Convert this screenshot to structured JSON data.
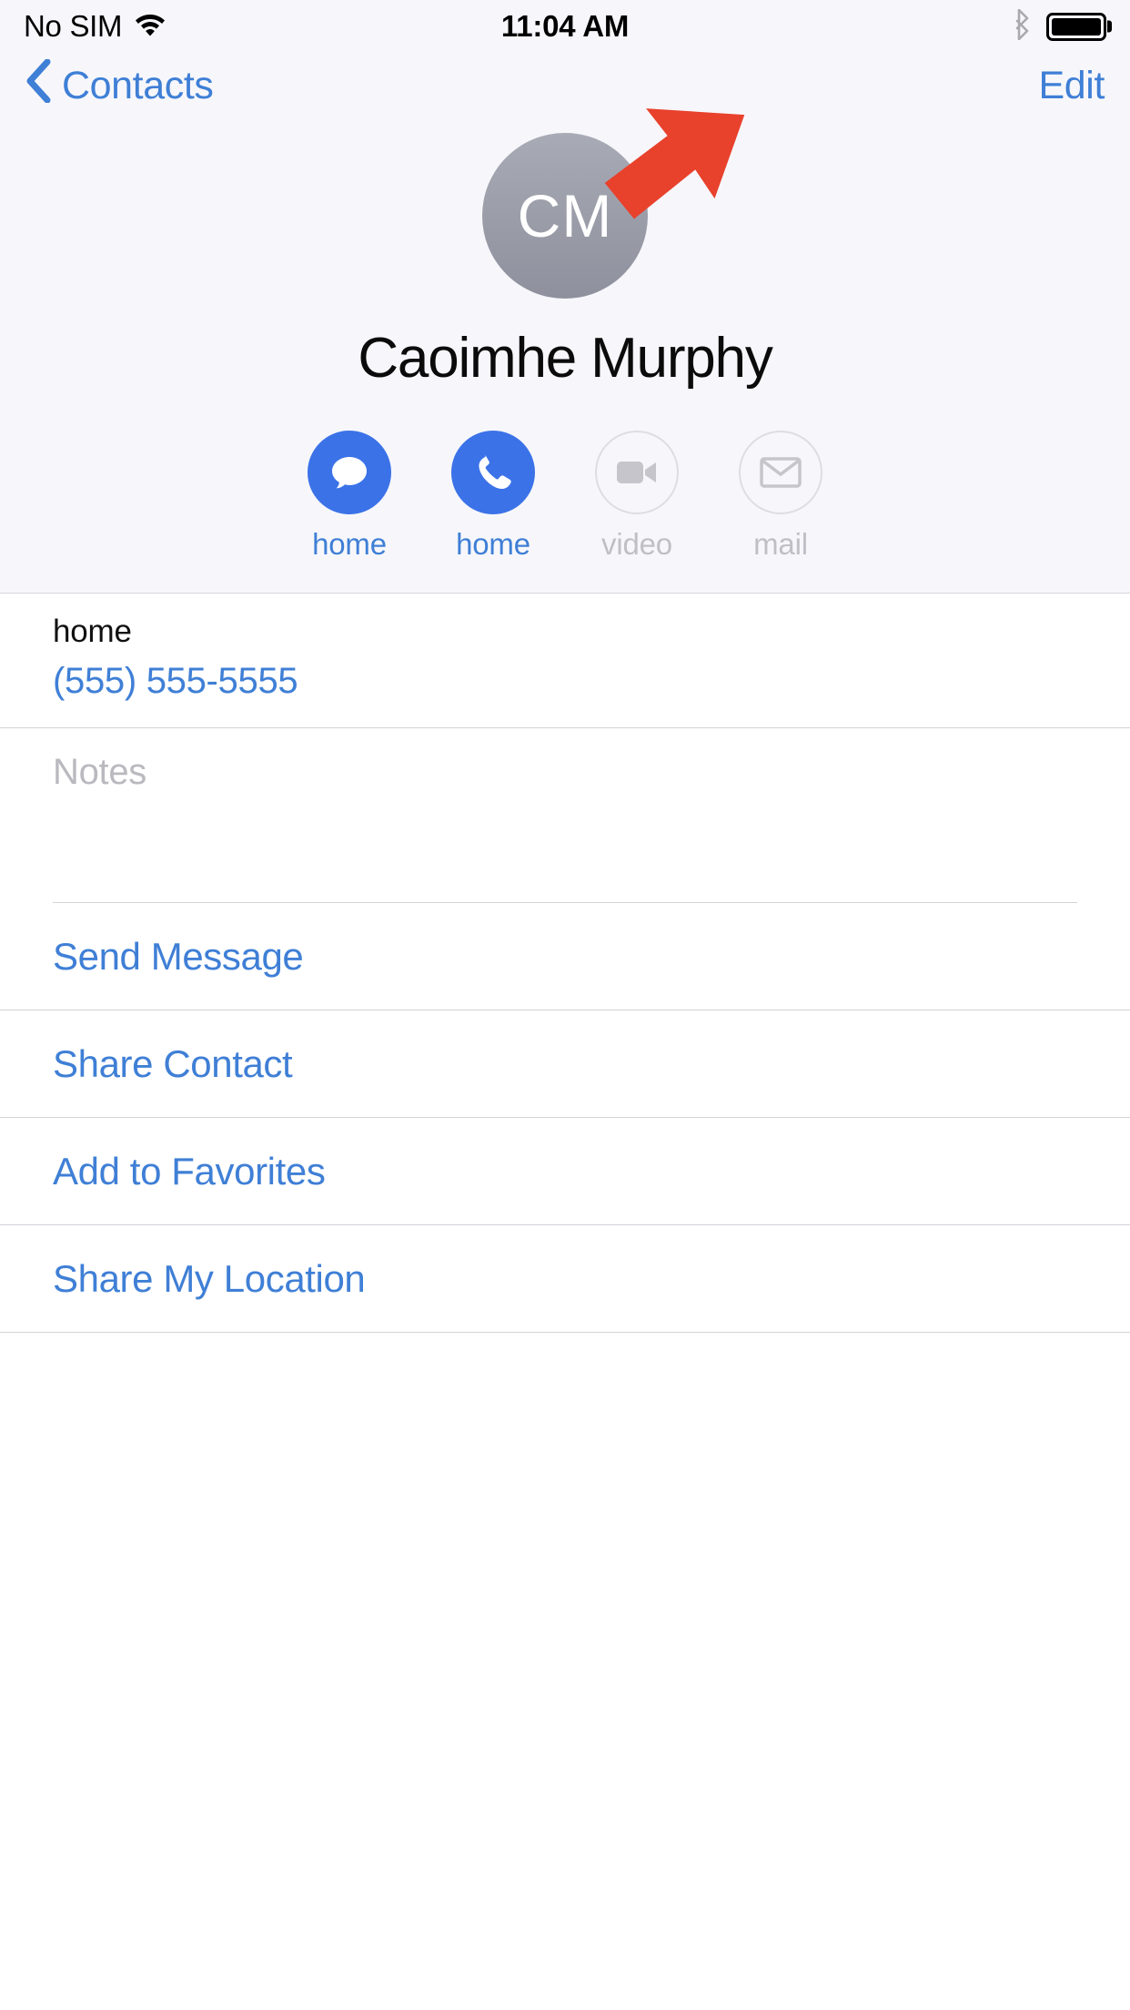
{
  "status_bar": {
    "carrier": "No SIM",
    "wifi_icon": "wifi-icon",
    "time": "11:04 AM",
    "bluetooth_icon": "bluetooth-icon",
    "battery_icon": "battery-full-icon",
    "battery_level_percent": 100
  },
  "nav_bar": {
    "back_icon": "chevron-left-icon",
    "back_label": "Contacts",
    "edit_label": "Edit"
  },
  "contact": {
    "initials": "CM",
    "name": "Caoimhe Murphy",
    "avatar_color": "#9a9da8"
  },
  "actions": [
    {
      "icon": "message-icon",
      "label": "home",
      "enabled": true
    },
    {
      "icon": "phone-icon",
      "label": "home",
      "enabled": true
    },
    {
      "icon": "video-camera-icon",
      "label": "video",
      "enabled": false
    },
    {
      "icon": "mail-icon",
      "label": "mail",
      "enabled": false
    }
  ],
  "phone_field": {
    "label": "home",
    "value": "(555) 555-5555"
  },
  "notes_field": {
    "placeholder": "Notes",
    "value": ""
  },
  "link_rows": [
    {
      "label": "Send Message"
    },
    {
      "label": "Share Contact"
    },
    {
      "label": "Add to Favorites"
    },
    {
      "label": "Share My Location"
    }
  ],
  "annotation": {
    "type": "arrow",
    "color": "#e8412c",
    "points_to": "Edit"
  },
  "colors": {
    "ios_blue": "#3f7fd6",
    "action_blue": "#3b72e8",
    "header_bg": "#f7f7fb",
    "disabled_gray": "#bfbfc6",
    "separator": "#d3d3d8"
  }
}
